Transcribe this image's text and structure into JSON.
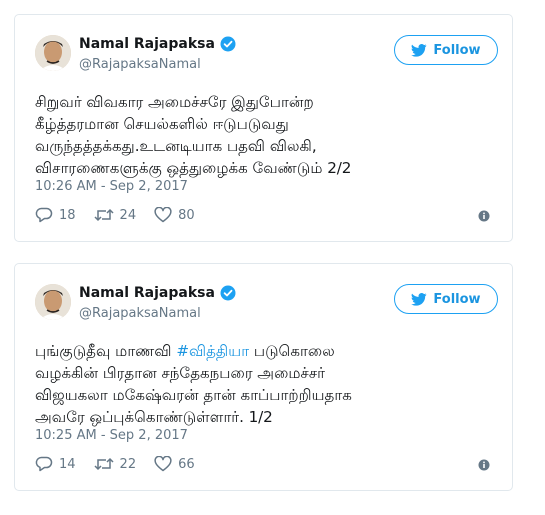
{
  "colors": {
    "accent": "#1da1f2",
    "text_primary": "#14171a",
    "text_secondary": "#657786",
    "border": "#e1e8ed"
  },
  "tweets": [
    {
      "author": {
        "name": "Namal Rajapaksa",
        "handle": "@RajapaksaNamal",
        "verified_icon": "verified-badge-icon"
      },
      "follow_label": "Follow",
      "text_lines": [
        "சிறுவர் விவகார அமைச்சரே இதுபோன்ற",
        "கீழ்த்தரமான செயல்களில் ஈடுபடுவது",
        "வருந்தத்தக்கது.உடனடியாக பதவி விலகி,",
        "விசாரணைகளுக்கு ஒத்துழைக்க வேண்டும் 2/2"
      ],
      "timestamp": "10:26 AM - Sep 2, 2017",
      "replies": "18",
      "retweets": "24",
      "likes": "80"
    },
    {
      "author": {
        "name": "Namal Rajapaksa",
        "handle": "@RajapaksaNamal",
        "verified_icon": "verified-badge-icon"
      },
      "follow_label": "Follow",
      "text_lines": [
        {
          "before": "புங்குடுதீவு மாணவி ",
          "hashtag": "#வித்தியா",
          "after": " படுகொலை"
        },
        "வழக்கின் பிரதான சந்தேகநபரை அமைச்சர்",
        "விஜயகலா மகேஷ்வரன் தான் காப்பாற்றியதாக",
        "அவரே ஒப்புக்கொண்டுள்ளார். 1/2"
      ],
      "timestamp": "10:25 AM - Sep 2, 2017",
      "replies": "14",
      "retweets": "22",
      "likes": "66"
    }
  ]
}
